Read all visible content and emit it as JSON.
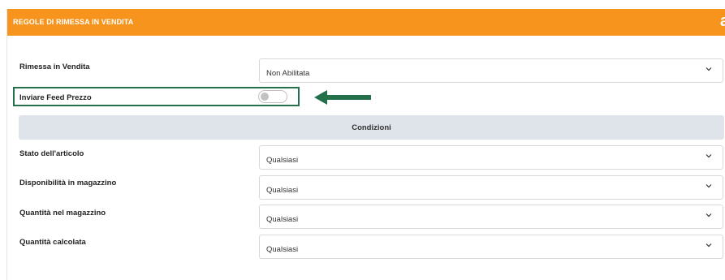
{
  "header": {
    "title": "REGOLE DI RIMESSA IN VENDITA",
    "brand_glyph": "a",
    "brand_icon": "amazon-logo-icon",
    "background_color": "#f7941d"
  },
  "rows": {
    "relist": {
      "label": "Rimessa in Vendita",
      "value": "Non Abilitata"
    },
    "price_feed": {
      "label": "Inviare Feed Prezzo",
      "enabled": false
    }
  },
  "annotation": {
    "color": "#23704a",
    "arrow_icon": "left-arrow-icon"
  },
  "conditions": {
    "title": "Condizioni",
    "items": [
      {
        "label": "Stato dell'articolo",
        "value": "Qualsiasi"
      },
      {
        "label": "Disponibilità in magazzino",
        "value": "Qualsiasi"
      },
      {
        "label": "Quantità nel magazzino",
        "value": "Qualsiasi"
      },
      {
        "label": "Quantità calcolata",
        "value": "Qualsiasi"
      }
    ]
  }
}
